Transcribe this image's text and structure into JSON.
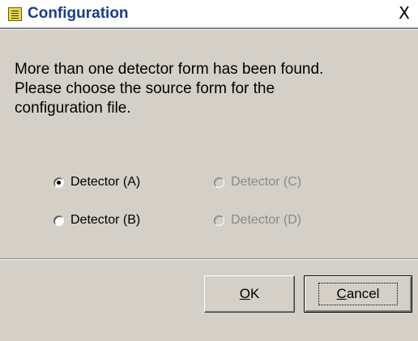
{
  "window": {
    "title": "Configuration",
    "close_glyph": "X"
  },
  "message": {
    "lines": [
      "More than one detector form has been found.",
      "Please choose the source form for the",
      "configuration file."
    ]
  },
  "options": [
    {
      "label": "Detector (A)",
      "selected": true,
      "enabled": true
    },
    {
      "label": "Detector (B)",
      "selected": false,
      "enabled": true
    },
    {
      "label": "Detector (C)",
      "selected": false,
      "enabled": false
    },
    {
      "label": "Detector (D)",
      "selected": false,
      "enabled": false
    }
  ],
  "buttons": {
    "ok": {
      "mnemonic": "O",
      "rest": "K"
    },
    "cancel": {
      "mnemonic": "C",
      "rest": "ancel"
    }
  }
}
